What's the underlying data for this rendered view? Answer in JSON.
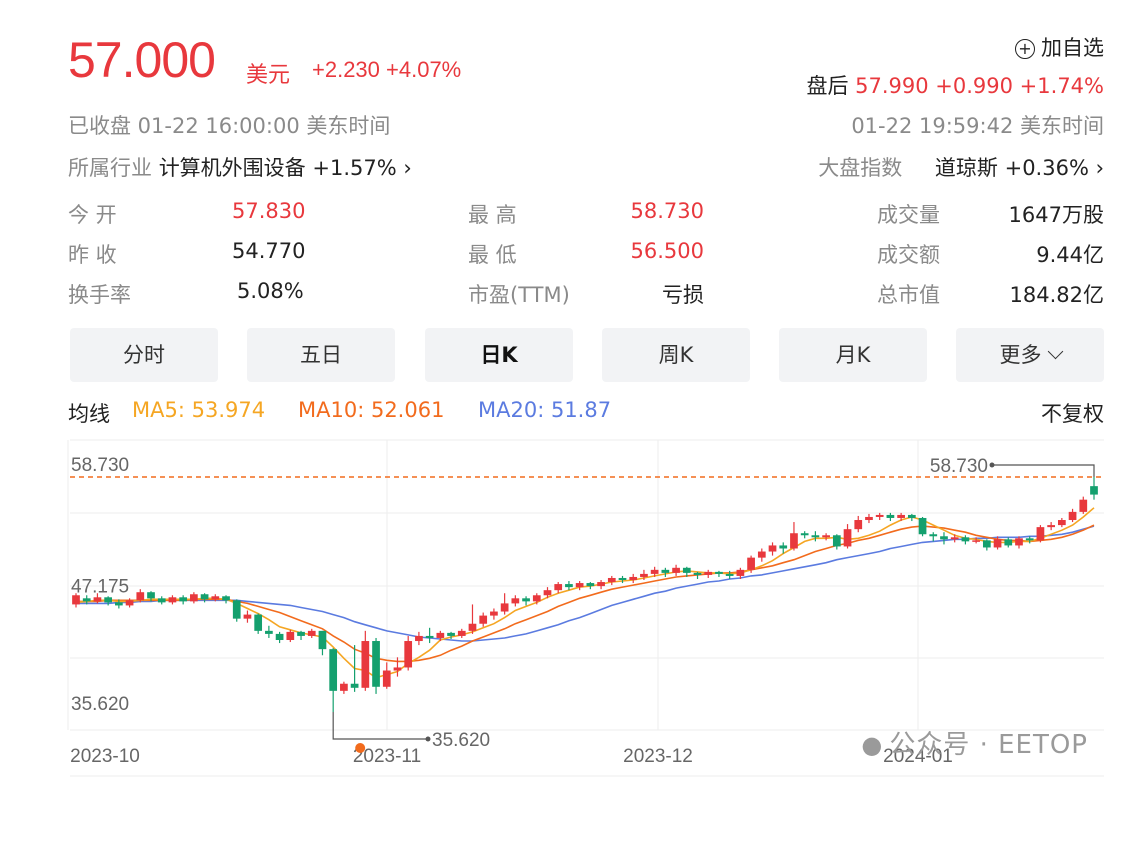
{
  "quote": {
    "price": "57.000",
    "currency": "美元",
    "change": "+2.230 +4.07%",
    "add_watchlist": "加自选",
    "after_hours_label": "盘后",
    "after_hours_value": "57.990 +0.990 +1.74%",
    "status": "已收盘  01-22 16:00:00  美东时间",
    "after_time": "01-22 19:59:42  美东时间",
    "industry_label": "所属行业",
    "industry_name": "计算机外围设备",
    "industry_change": "+1.57%",
    "index_label": "大盘指数",
    "index_name": "道琼斯",
    "index_change": "+0.36%"
  },
  "stats": {
    "open_label": "今  开",
    "open": "57.830",
    "prev_close_label": "昨  收",
    "prev_close": "54.770",
    "turnover_label": "换手率",
    "turnover": "5.08%",
    "high_label": "最  高",
    "high": "58.730",
    "low_label": "最  低",
    "low": "56.500",
    "pe_label": "市盈(TTM)",
    "pe": "亏损",
    "volume_label": "成交量",
    "volume": "1647万股",
    "amount_label": "成交额",
    "amount": "9.44亿",
    "mcap_label": "总市值",
    "mcap": "184.82亿"
  },
  "tabs": [
    "分时",
    "五日",
    "日K",
    "周K",
    "月K",
    "更多"
  ],
  "active_tab": "日K",
  "ma_legend": {
    "label": "均线",
    "ma5": "MA5: 53.974",
    "ma10": "MA10: 52.061",
    "ma20": "MA20: 51.87",
    "adjust": "不复权"
  },
  "colors": {
    "up": "#e8383d",
    "down": "#14a06e",
    "ma5": "#f5a623",
    "ma10": "#f26b1d",
    "ma20": "#5b7be0"
  },
  "watermark": "公众号 · EETOP",
  "chart_data": {
    "type": "candlestick",
    "ylim": [
      35.62,
      58.73
    ],
    "y_ticks": [
      "58.730",
      "47.175",
      "35.620"
    ],
    "x_ticks": [
      "2023-10",
      "2023-11",
      "2023-12",
      "2024-01"
    ],
    "max_label": "58.730",
    "min_label": "35.620",
    "candles": [
      [
        46.2,
        47.1,
        45.9,
        47.3
      ],
      [
        46.8,
        46.5,
        46.2,
        47.1
      ],
      [
        46.5,
        46.9,
        46.3,
        47.3
      ],
      [
        46.9,
        46.4,
        46.1,
        47.0
      ],
      [
        46.4,
        46.1,
        45.8,
        46.7
      ],
      [
        46.1,
        46.6,
        45.9,
        46.8
      ],
      [
        46.6,
        47.4,
        46.4,
        47.7
      ],
      [
        47.4,
        46.8,
        46.5,
        47.5
      ],
      [
        46.8,
        46.4,
        46.2,
        47.0
      ],
      [
        46.4,
        46.9,
        46.2,
        47.1
      ],
      [
        46.9,
        46.5,
        46.2,
        47.1
      ],
      [
        46.5,
        47.2,
        46.3,
        47.4
      ],
      [
        47.2,
        46.7,
        46.4,
        47.3
      ],
      [
        46.7,
        47.0,
        46.5,
        47.2
      ],
      [
        47.0,
        46.6,
        46.3,
        47.1
      ],
      [
        46.6,
        44.8,
        44.5,
        46.7
      ],
      [
        44.8,
        45.2,
        44.4,
        45.6
      ],
      [
        45.2,
        43.6,
        43.3,
        45.3
      ],
      [
        43.6,
        43.3,
        42.9,
        44.1
      ],
      [
        43.3,
        42.7,
        42.4,
        43.5
      ],
      [
        42.7,
        43.5,
        42.5,
        43.7
      ],
      [
        43.5,
        43.1,
        42.7,
        43.6
      ],
      [
        43.1,
        43.6,
        42.9,
        43.8
      ],
      [
        43.6,
        41.8,
        41.2,
        43.6
      ],
      [
        41.8,
        37.7,
        35.62,
        41.9
      ],
      [
        37.7,
        38.4,
        37.4,
        38.6
      ],
      [
        38.4,
        38.0,
        37.6,
        42.2
      ],
      [
        38.0,
        42.6,
        37.7,
        43.6
      ],
      [
        42.6,
        38.1,
        37.4,
        42.9
      ],
      [
        38.1,
        39.7,
        37.9,
        40.5
      ],
      [
        39.7,
        40.0,
        39.1,
        41.0
      ],
      [
        40.0,
        42.6,
        39.7,
        43.1
      ],
      [
        42.6,
        43.1,
        42.2,
        43.5
      ],
      [
        43.1,
        42.9,
        42.4,
        43.9
      ],
      [
        42.9,
        43.4,
        42.6,
        43.6
      ],
      [
        43.4,
        43.1,
        42.8,
        43.5
      ],
      [
        43.1,
        43.6,
        42.9,
        43.8
      ],
      [
        43.6,
        44.3,
        43.3,
        46.2
      ],
      [
        44.3,
        45.1,
        44.0,
        45.4
      ],
      [
        45.1,
        45.5,
        44.7,
        45.8
      ],
      [
        45.5,
        46.3,
        45.2,
        47.3
      ],
      [
        46.3,
        46.8,
        46.0,
        47.1
      ],
      [
        46.8,
        46.5,
        46.1,
        47.0
      ],
      [
        46.5,
        47.1,
        46.2,
        47.3
      ],
      [
        47.1,
        47.6,
        46.8,
        47.9
      ],
      [
        47.6,
        48.2,
        47.3,
        48.4
      ],
      [
        48.2,
        47.9,
        47.6,
        48.5
      ],
      [
        47.9,
        48.3,
        47.6,
        48.5
      ],
      [
        48.3,
        48.0,
        47.7,
        48.4
      ],
      [
        48.0,
        48.4,
        47.7,
        48.6
      ],
      [
        48.4,
        48.8,
        48.1,
        49.0
      ],
      [
        48.8,
        48.6,
        48.3,
        49.0
      ],
      [
        48.6,
        48.9,
        48.3,
        49.2
      ],
      [
        48.9,
        49.2,
        48.6,
        49.6
      ],
      [
        49.2,
        49.6,
        48.9,
        49.9
      ],
      [
        49.6,
        49.3,
        48.9,
        49.8
      ],
      [
        49.3,
        49.8,
        49.0,
        50.1
      ],
      [
        49.8,
        49.3,
        48.9,
        49.9
      ],
      [
        49.3,
        49.1,
        48.7,
        49.4
      ],
      [
        49.1,
        49.4,
        48.8,
        49.6
      ],
      [
        49.4,
        49.2,
        48.9,
        49.5
      ],
      [
        49.2,
        49.0,
        48.7,
        49.5
      ],
      [
        49.0,
        49.6,
        48.7,
        49.8
      ],
      [
        49.6,
        50.8,
        49.3,
        51.0
      ],
      [
        50.8,
        51.4,
        50.4,
        51.7
      ],
      [
        51.4,
        52.0,
        51.0,
        52.3
      ],
      [
        52.0,
        51.7,
        51.2,
        52.3
      ],
      [
        51.7,
        53.2,
        51.5,
        54.3
      ],
      [
        53.2,
        53.0,
        52.7,
        53.4
      ],
      [
        53.0,
        52.8,
        52.4,
        53.4
      ],
      [
        52.8,
        53.0,
        52.5,
        53.2
      ],
      [
        53.0,
        51.9,
        51.6,
        53.1
      ],
      [
        51.9,
        53.6,
        51.7,
        54.1
      ],
      [
        53.6,
        54.5,
        53.3,
        54.9
      ],
      [
        54.5,
        54.8,
        54.2,
        55.1
      ],
      [
        54.8,
        55.0,
        54.5,
        55.2
      ],
      [
        55.0,
        54.7,
        54.4,
        55.2
      ],
      [
        54.7,
        55.0,
        54.4,
        55.2
      ],
      [
        55.0,
        54.7,
        54.4,
        55.1
      ],
      [
        54.7,
        53.1,
        52.9,
        54.8
      ],
      [
        53.1,
        52.9,
        52.4,
        53.3
      ],
      [
        52.9,
        52.6,
        52.1,
        53.3
      ],
      [
        52.6,
        52.8,
        52.3,
        53.1
      ],
      [
        52.8,
        52.4,
        52.1,
        53.0
      ],
      [
        52.4,
        52.5,
        52.2,
        52.8
      ],
      [
        52.5,
        51.8,
        51.5,
        52.6
      ],
      [
        51.8,
        52.6,
        51.6,
        52.9
      ],
      [
        52.6,
        52.0,
        51.8,
        52.8
      ],
      [
        52.0,
        52.7,
        51.7,
        52.9
      ],
      [
        52.7,
        52.5,
        52.2,
        52.9
      ],
      [
        52.5,
        53.8,
        52.3,
        54.0
      ],
      [
        53.8,
        54.0,
        53.5,
        54.3
      ],
      [
        54.0,
        54.5,
        53.8,
        54.7
      ],
      [
        54.5,
        55.3,
        54.3,
        55.6
      ],
      [
        55.3,
        56.5,
        55.1,
        56.8
      ],
      [
        57.83,
        57.0,
        56.5,
        58.73
      ]
    ],
    "ma5": [
      46.4,
      46.5,
      46.6,
      46.6,
      46.5,
      46.5,
      46.6,
      46.7,
      46.7,
      46.7,
      46.7,
      46.7,
      46.8,
      46.8,
      46.7,
      46.3,
      45.8,
      45.3,
      44.7,
      44.0,
      43.7,
      43.4,
      43.2,
      43.0,
      42.0,
      40.9,
      39.9,
      39.7,
      39.0,
      39.3,
      39.6,
      40.4,
      41.0,
      41.7,
      42.7,
      43.0,
      43.2,
      43.5,
      43.9,
      44.3,
      44.9,
      45.6,
      46.0,
      46.4,
      46.9,
      47.3,
      47.6,
      47.9,
      48.0,
      48.2,
      48.4,
      48.5,
      48.6,
      48.8,
      49.0,
      49.2,
      49.4,
      49.5,
      49.4,
      49.3,
      49.3,
      49.2,
      49.3,
      49.6,
      50.0,
      50.5,
      51.2,
      51.8,
      52.4,
      52.7,
      52.7,
      52.8,
      52.6,
      52.7,
      53.0,
      53.4,
      54.0,
      54.5,
      54.8,
      54.5,
      54.0,
      53.5,
      53.0,
      52.7,
      52.6,
      52.4,
      52.3,
      52.3,
      52.4,
      52.4,
      52.7,
      53.1,
      53.5,
      54.0,
      54.8,
      55.7
    ],
    "ma10": [
      46.5,
      46.5,
      46.5,
      46.6,
      46.6,
      46.6,
      46.6,
      46.6,
      46.6,
      46.6,
      46.6,
      46.7,
      46.7,
      46.7,
      46.7,
      46.5,
      46.3,
      46.0,
      45.7,
      45.4,
      45.0,
      44.6,
      44.2,
      43.8,
      43.1,
      42.5,
      41.8,
      41.4,
      40.9,
      40.7,
      40.6,
      40.6,
      40.7,
      40.9,
      41.2,
      41.7,
      42.1,
      42.6,
      43.0,
      43.4,
      43.8,
      44.3,
      44.7,
      45.1,
      45.5,
      46.0,
      46.4,
      46.8,
      47.1,
      47.4,
      47.7,
      47.9,
      48.1,
      48.3,
      48.5,
      48.7,
      48.9,
      49.0,
      49.1,
      49.2,
      49.3,
      49.3,
      49.4,
      49.6,
      49.8,
      50.0,
      50.3,
      50.6,
      51.0,
      51.4,
      51.7,
      52.0,
      52.2,
      52.5,
      52.7,
      53.0,
      53.3,
      53.6,
      53.8,
      53.9,
      53.8,
      53.7,
      53.5,
      53.3,
      53.0,
      52.8,
      52.6,
      52.5,
      52.5,
      52.4,
      52.5,
      52.6,
      52.8,
      53.1,
      53.5,
      54.0
    ],
    "ma20": [
      46.3,
      46.3,
      46.3,
      46.3,
      46.4,
      46.4,
      46.5,
      46.5,
      46.6,
      46.6,
      46.6,
      46.6,
      46.6,
      46.6,
      46.6,
      46.6,
      46.5,
      46.4,
      46.3,
      46.2,
      46.1,
      45.9,
      45.7,
      45.5,
      45.2,
      44.9,
      44.5,
      44.2,
      43.9,
      43.6,
      43.4,
      43.2,
      43.0,
      42.9,
      42.8,
      42.7,
      42.6,
      42.6,
      42.7,
      42.8,
      42.9,
      43.1,
      43.3,
      43.6,
      43.9,
      44.2,
      44.6,
      44.9,
      45.3,
      45.7,
      46.1,
      46.4,
      46.7,
      47.0,
      47.3,
      47.5,
      47.8,
      48.0,
      48.2,
      48.4,
      48.5,
      48.7,
      48.8,
      49.0,
      49.1,
      49.3,
      49.5,
      49.7,
      49.9,
      50.1,
      50.3,
      50.6,
      50.8,
      51.0,
      51.2,
      51.4,
      51.7,
      51.9,
      52.1,
      52.3,
      52.4,
      52.5,
      52.6,
      52.6,
      52.7,
      52.7,
      52.8,
      52.8,
      52.8,
      52.9,
      52.9,
      53.0,
      53.1,
      53.3,
      53.6,
      53.9
    ]
  }
}
